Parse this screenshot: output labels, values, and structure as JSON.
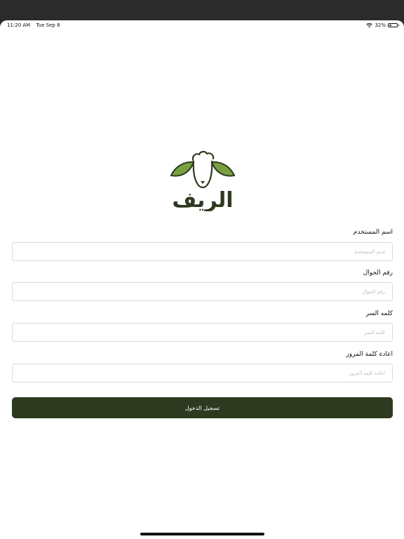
{
  "status_bar": {
    "time": "11:20 AM",
    "date": "Tue Sep 8",
    "battery": "32%",
    "battery_level": 0.32
  },
  "brand": {
    "logo_text": "الريف"
  },
  "form": {
    "username": {
      "label": "اسم المستخدم",
      "placeholder": "اسم المستخدم"
    },
    "phone": {
      "label": "رقم الجوال",
      "placeholder": "رقم الجوال"
    },
    "password": {
      "label": "كلمه السر",
      "placeholder": "كلمه السر"
    },
    "confirm_password": {
      "label": "اعادة كلمة المرور",
      "placeholder": "اعادة كلمة المرور"
    },
    "submit_label": "تسجيل الدخول"
  },
  "colors": {
    "primary": "#2e3a20",
    "leaf": "#7aa140",
    "background": "#ffffff"
  }
}
